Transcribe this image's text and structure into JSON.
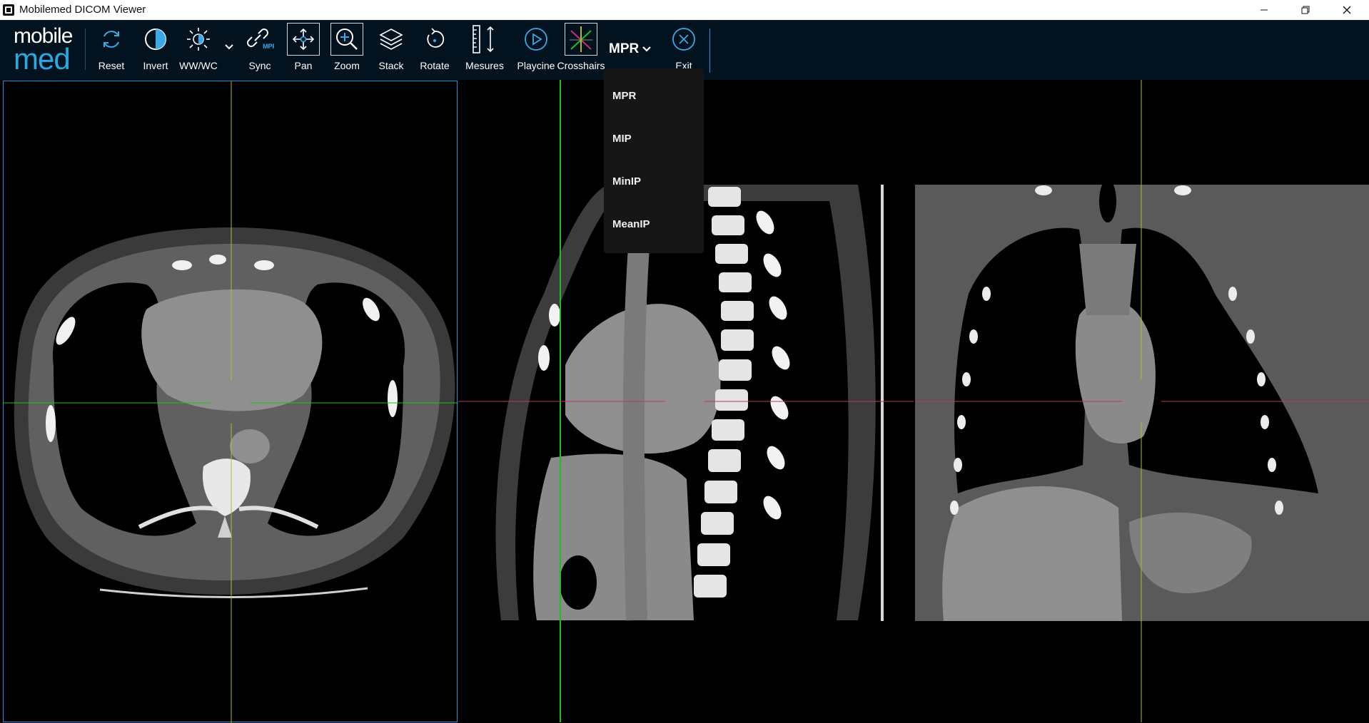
{
  "window": {
    "title": "Mobilemed DICOM Viewer",
    "controls": [
      "minimize",
      "restore",
      "close"
    ]
  },
  "logo": {
    "line1": "mobile",
    "line2": "med",
    "accent": "#29a9e0"
  },
  "toolbar": {
    "tools": [
      {
        "name": "reset",
        "label": "Reset",
        "icon": "refresh-icon"
      },
      {
        "name": "invert",
        "label": "Invert",
        "icon": "half-circle-icon"
      },
      {
        "name": "wwwc",
        "label": "WW/WC",
        "icon": "sun-icon"
      },
      {
        "name": "sync",
        "label": "Sync",
        "icon": "link-mpr-icon",
        "badge": "MPR"
      },
      {
        "name": "pan",
        "label": "Pan",
        "icon": "move-arrows-icon",
        "active": true
      },
      {
        "name": "zoom",
        "label": "Zoom",
        "icon": "zoom-in-icon",
        "active": true
      },
      {
        "name": "stack",
        "label": "Stack",
        "icon": "layers-icon"
      },
      {
        "name": "rotate",
        "label": "Rotate",
        "icon": "rotate-icon"
      },
      {
        "name": "measures",
        "label": "Mesures",
        "icon": "ruler-icon"
      },
      {
        "name": "playcine",
        "label": "Playcine",
        "icon": "play-circle-icon"
      },
      {
        "name": "crosshairs",
        "label": "Crosshairs",
        "icon": "crosshairs-icon",
        "active": true
      },
      {
        "name": "exit",
        "label": "Exit",
        "icon": "close-circle-icon"
      }
    ],
    "mode_selector": {
      "label": "MPR",
      "icon": "chevron-down-icon"
    }
  },
  "mode_menu": {
    "options": [
      "MPR",
      "MIP",
      "MinIP",
      "MeanIP"
    ]
  },
  "colors": {
    "toolbar_bg": "#02121f",
    "active_viewport_border": "#2e8fd6",
    "crosshair_axial": "#b9b92a",
    "crosshair_sagittal": "#1fbf1f",
    "crosshair_coronal": "#c0307a"
  }
}
